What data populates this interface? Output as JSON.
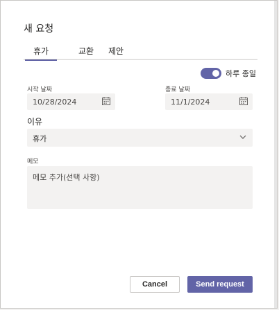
{
  "dialog": {
    "title": "새 요청",
    "tabs": [
      {
        "label": "휴가",
        "active": true
      },
      {
        "label": "교환",
        "active": false
      },
      {
        "label": "제안",
        "active": false
      }
    ],
    "all_day": {
      "label": "하루 종일",
      "on": true
    },
    "start_date": {
      "label": "시작 날짜",
      "value": "10/28/2024"
    },
    "end_date": {
      "label": "종료 날짜",
      "value": "11/1/2024"
    },
    "reason": {
      "label": "이유",
      "value": "휴가"
    },
    "memo": {
      "label": "메모",
      "placeholder": "메모 추가(선택 사항)"
    },
    "buttons": {
      "cancel": "Cancel",
      "send": "Send request"
    },
    "colors": {
      "accent": "#6264a7",
      "field_bg": "#f3f2f1"
    }
  }
}
